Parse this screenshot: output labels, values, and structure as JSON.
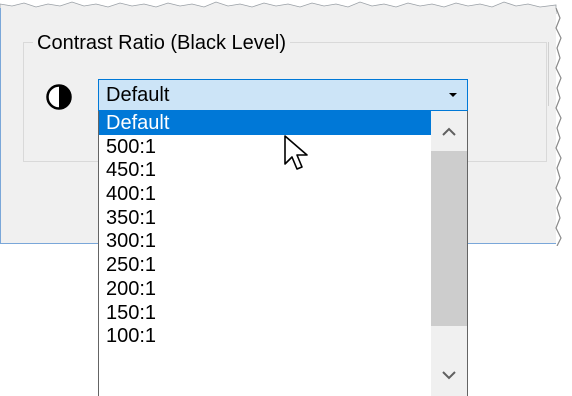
{
  "group": {
    "label": "Contrast Ratio (Black Level)"
  },
  "contrast_icon": "contrast-half-circle-icon",
  "combo": {
    "selected_value": "Default",
    "arrow_icon": "dropdown-arrow-icon"
  },
  "dropdown": {
    "items": [
      {
        "label": "Default",
        "selected": true
      },
      {
        "label": "500:1",
        "selected": false
      },
      {
        "label": "450:1",
        "selected": false
      },
      {
        "label": "400:1",
        "selected": false
      },
      {
        "label": "350:1",
        "selected": false
      },
      {
        "label": "300:1",
        "selected": false
      },
      {
        "label": "250:1",
        "selected": false
      },
      {
        "label": "200:1",
        "selected": false
      },
      {
        "label": "150:1",
        "selected": false
      },
      {
        "label": "100:1",
        "selected": false
      }
    ],
    "scroll_up_icon": "chevron-up-icon",
    "scroll_down_icon": "chevron-down-icon"
  },
  "colors": {
    "selection": "#0078d7",
    "combo_focus_bg": "#cce4f7",
    "dialog_bg": "#f0f0f0"
  }
}
